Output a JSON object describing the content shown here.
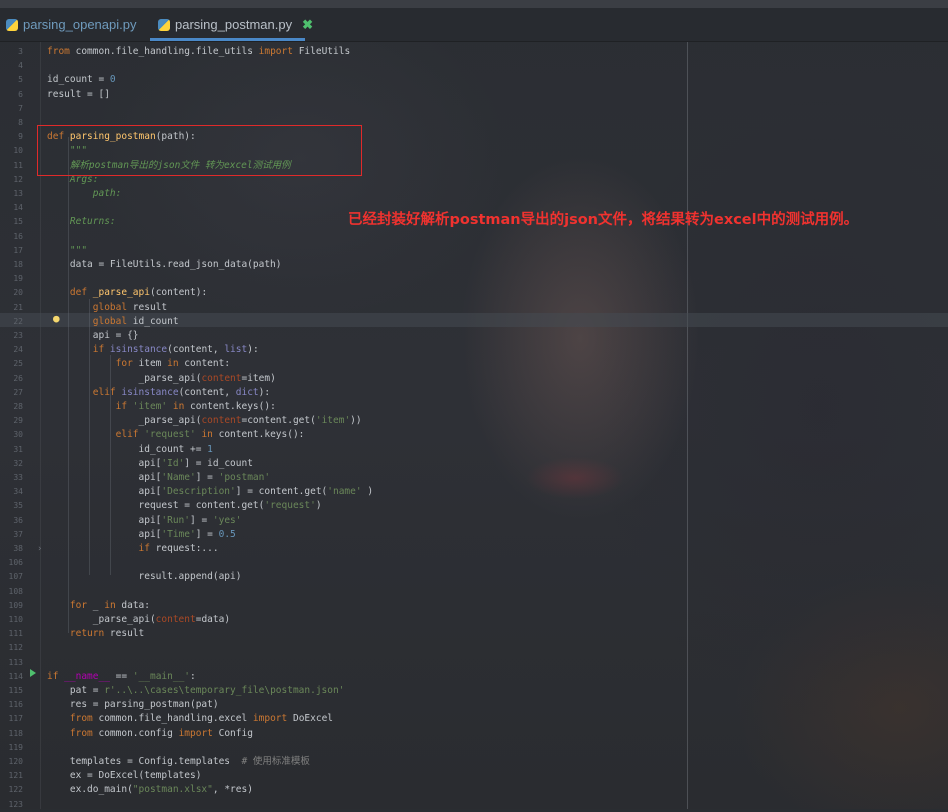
{
  "tabs": [
    {
      "label": "parsing_openapi.py"
    },
    {
      "label": "parsing_postman.py",
      "active": true
    }
  ],
  "close_symbol": "✖",
  "annotation": {
    "text": "已经封装好解析postman导出的json文件，将结果转为excel中的测试用例。",
    "color": "#f0322f"
  },
  "code_lines": [
    {
      "n": "3",
      "t": [
        [
          "kw",
          "from "
        ],
        [
          "",
          "common.file_handling.file_utils "
        ],
        [
          "kw",
          "import "
        ],
        [
          "",
          "FileUtils"
        ]
      ]
    },
    {
      "n": "4",
      "t": []
    },
    {
      "n": "5",
      "t": [
        [
          "",
          "id_count = "
        ],
        [
          "num",
          "0"
        ]
      ]
    },
    {
      "n": "6",
      "t": [
        [
          "",
          "result = []"
        ]
      ]
    },
    {
      "n": "7",
      "t": []
    },
    {
      "n": "8",
      "t": []
    },
    {
      "n": "9",
      "t": [
        [
          "kw",
          "def "
        ],
        [
          "fn",
          "parsing_postman"
        ],
        [
          "",
          "(path):"
        ]
      ]
    },
    {
      "n": "10",
      "t": [
        [
          "doc",
          "    \"\"\""
        ]
      ]
    },
    {
      "n": "11",
      "t": [
        [
          "doc",
          "    解析postman导出的json文件 转为excel测试用例"
        ]
      ]
    },
    {
      "n": "12",
      "t": [
        [
          "doc",
          "    Args:"
        ]
      ]
    },
    {
      "n": "13",
      "t": [
        [
          "doc",
          "        path:"
        ]
      ]
    },
    {
      "n": "14",
      "t": []
    },
    {
      "n": "15",
      "t": [
        [
          "doc",
          "    Returns:"
        ]
      ]
    },
    {
      "n": "16",
      "t": []
    },
    {
      "n": "17",
      "t": [
        [
          "doc",
          "    \"\"\""
        ]
      ]
    },
    {
      "n": "18",
      "t": [
        [
          "",
          "    data = FileUtils.read_json_data(path)"
        ]
      ]
    },
    {
      "n": "19",
      "t": []
    },
    {
      "n": "20",
      "t": [
        [
          "kw",
          "    def "
        ],
        [
          "fn",
          "_parse_api"
        ],
        [
          "",
          "(content):"
        ]
      ]
    },
    {
      "n": "21",
      "t": [
        [
          "kw",
          "        global "
        ],
        [
          "",
          "result"
        ]
      ]
    },
    {
      "n": "22",
      "t": [
        [
          "kw",
          "        global "
        ],
        [
          "",
          "id_count"
        ]
      ]
    },
    {
      "n": "23",
      "t": [
        [
          "",
          "        api = {}"
        ]
      ]
    },
    {
      "n": "24",
      "t": [
        [
          "kw",
          "        if "
        ],
        [
          "builtin",
          "isinstance"
        ],
        [
          "",
          "(content, "
        ],
        [
          "builtin",
          "list"
        ],
        [
          "",
          "):"
        ]
      ]
    },
    {
      "n": "25",
      "t": [
        [
          "kw",
          "            for "
        ],
        [
          "",
          "item "
        ],
        [
          "kw",
          "in "
        ],
        [
          "",
          "content:"
        ]
      ]
    },
    {
      "n": "26",
      "t": [
        [
          "",
          "                _parse_api("
        ],
        [
          "param",
          "content"
        ],
        [
          "",
          "=item)"
        ]
      ]
    },
    {
      "n": "27",
      "t": [
        [
          "kw",
          "        elif "
        ],
        [
          "builtin",
          "isinstance"
        ],
        [
          "",
          "(content, "
        ],
        [
          "builtin",
          "dict"
        ],
        [
          "",
          "):"
        ]
      ]
    },
    {
      "n": "28",
      "t": [
        [
          "kw",
          "            if "
        ],
        [
          "str",
          "'item' "
        ],
        [
          "kw",
          "in "
        ],
        [
          "",
          "content.keys():"
        ]
      ]
    },
    {
      "n": "29",
      "t": [
        [
          "",
          "                _parse_api("
        ],
        [
          "param",
          "content"
        ],
        [
          "",
          "=content.get("
        ],
        [
          "str",
          "'item'"
        ],
        [
          "",
          "))"
        ]
      ]
    },
    {
      "n": "30",
      "t": [
        [
          "kw",
          "            elif "
        ],
        [
          "str",
          "'request' "
        ],
        [
          "kw",
          "in "
        ],
        [
          "",
          "content.keys():"
        ]
      ]
    },
    {
      "n": "31",
      "t": [
        [
          "",
          "                id_count += "
        ],
        [
          "num",
          "1"
        ]
      ]
    },
    {
      "n": "32",
      "t": [
        [
          "",
          "                api["
        ],
        [
          "str",
          "'Id'"
        ],
        [
          "",
          "] = id_count"
        ]
      ]
    },
    {
      "n": "33",
      "t": [
        [
          "",
          "                api["
        ],
        [
          "str",
          "'Name'"
        ],
        [
          "",
          "] = "
        ],
        [
          "str",
          "'postman'"
        ]
      ]
    },
    {
      "n": "34",
      "t": [
        [
          "",
          "                api["
        ],
        [
          "str",
          "'Description'"
        ],
        [
          "",
          "] = content.get("
        ],
        [
          "str",
          "'name'"
        ],
        [
          "",
          " )"
        ]
      ]
    },
    {
      "n": "35",
      "t": [
        [
          "",
          "                request = content.get("
        ],
        [
          "str",
          "'request'"
        ],
        [
          "",
          ")"
        ]
      ]
    },
    {
      "n": "36",
      "t": [
        [
          "",
          "                api["
        ],
        [
          "str",
          "'Run'"
        ],
        [
          "",
          "] = "
        ],
        [
          "str",
          "'yes'"
        ]
      ]
    },
    {
      "n": "37",
      "t": [
        [
          "",
          "                api["
        ],
        [
          "str",
          "'Time'"
        ],
        [
          "",
          "] = "
        ],
        [
          "num",
          "0.5"
        ]
      ]
    },
    {
      "n": "38",
      "t": [
        [
          "kw",
          "                if "
        ],
        [
          "",
          "request:..."
        ]
      ]
    },
    {
      "n": "106",
      "t": []
    },
    {
      "n": "107",
      "t": [
        [
          "",
          "                result.append(api)"
        ]
      ]
    },
    {
      "n": "108",
      "t": []
    },
    {
      "n": "109",
      "t": [
        [
          "kw",
          "    for "
        ],
        [
          "",
          "_ "
        ],
        [
          "kw",
          "in "
        ],
        [
          "",
          "data:"
        ]
      ]
    },
    {
      "n": "110",
      "t": [
        [
          "",
          "        _parse_api("
        ],
        [
          "param",
          "content"
        ],
        [
          "",
          "=data)"
        ]
      ]
    },
    {
      "n": "111",
      "t": [
        [
          "kw",
          "    return "
        ],
        [
          "",
          "result"
        ]
      ]
    },
    {
      "n": "112",
      "t": []
    },
    {
      "n": "113",
      "t": []
    },
    {
      "n": "114",
      "t": [
        [
          "kw",
          "if "
        ],
        [
          "sp",
          "__name__"
        ],
        [
          "",
          " == "
        ],
        [
          "str",
          "'__main__'"
        ],
        [
          "",
          ":"
        ]
      ]
    },
    {
      "n": "115",
      "t": [
        [
          "",
          "    pat = "
        ],
        [
          "str",
          "r'..\\..\\cases\\temporary_file\\postman.json'"
        ]
      ]
    },
    {
      "n": "116",
      "t": [
        [
          "",
          "    res = parsing_postman(pat)"
        ]
      ]
    },
    {
      "n": "117",
      "t": [
        [
          "kw",
          "    from "
        ],
        [
          "",
          "common.file_handling.excel "
        ],
        [
          "kw",
          "import "
        ],
        [
          "",
          "DoExcel"
        ]
      ]
    },
    {
      "n": "118",
      "t": [
        [
          "kw",
          "    from "
        ],
        [
          "",
          "common.config "
        ],
        [
          "kw",
          "import "
        ],
        [
          "",
          "Config"
        ]
      ]
    },
    {
      "n": "119",
      "t": []
    },
    {
      "n": "120",
      "t": [
        [
          "",
          "    templates = Config.templates  "
        ],
        [
          "cmt",
          "# 使用标准模板"
        ]
      ]
    },
    {
      "n": "121",
      "t": [
        [
          "",
          "    ex = DoExcel(templates)"
        ]
      ]
    },
    {
      "n": "122",
      "t": [
        [
          "",
          "    ex.do_main("
        ],
        [
          "str",
          "\"postman.xlsx\""
        ],
        [
          "",
          ", *res)"
        ]
      ]
    },
    {
      "n": "123",
      "t": []
    }
  ]
}
